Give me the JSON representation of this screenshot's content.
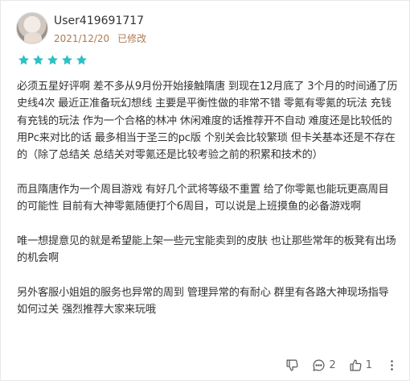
{
  "review": {
    "username": "User419691717",
    "date": "2021/12/20",
    "modified_label": "已修改",
    "rating": 5,
    "paragraphs": [
      "必须五星好评啊 差不多从9月份开始接触隋唐 到现在12月底了 3个月的时间通了历史线4次 最近正准备玩幻想线 主要是平衡性做的非常不错 零氪有零氪的玩法 充钱有充钱的玩法 作为一个合格的林冲 休闲难度的话推荐开不自动 难度还是比较低的 用Pc来对比的话 最多相当于圣三的pc版 个别关会比较繁琐 但卡关基本还是不存在的（除了总结关 总结关对零氪还是比较考验之前的积累和技术的）",
      "而且隋唐作为一个周目游戏 有好几个武将等级不重置 给了你零氪也能玩更高周目的可能性 目前有大神零氪随便打个6周目，可以说是上班摸鱼的必备游戏啊",
      "唯一想提意见的就是希望能上架一些元宝能卖到的皮肤 也让那些常年的板凳有出场的机会啊",
      "另外客服小姐姐的服务也异常的周到 管理异常的有耐心 群里有各路大神现场指导如何过关 强烈推荐大家来玩哦"
    ]
  },
  "actions": {
    "comment_count": "2",
    "like_count": "1"
  },
  "icons": {
    "star": "star-icon",
    "more": "more-icon",
    "dislike": "thumbs-down-icon",
    "comment": "comment-icon",
    "like": "thumbs-up-icon",
    "menu": "more-icon"
  },
  "colors": {
    "star": "#2ec0c4",
    "date": "#b07a52",
    "text": "#333333"
  }
}
